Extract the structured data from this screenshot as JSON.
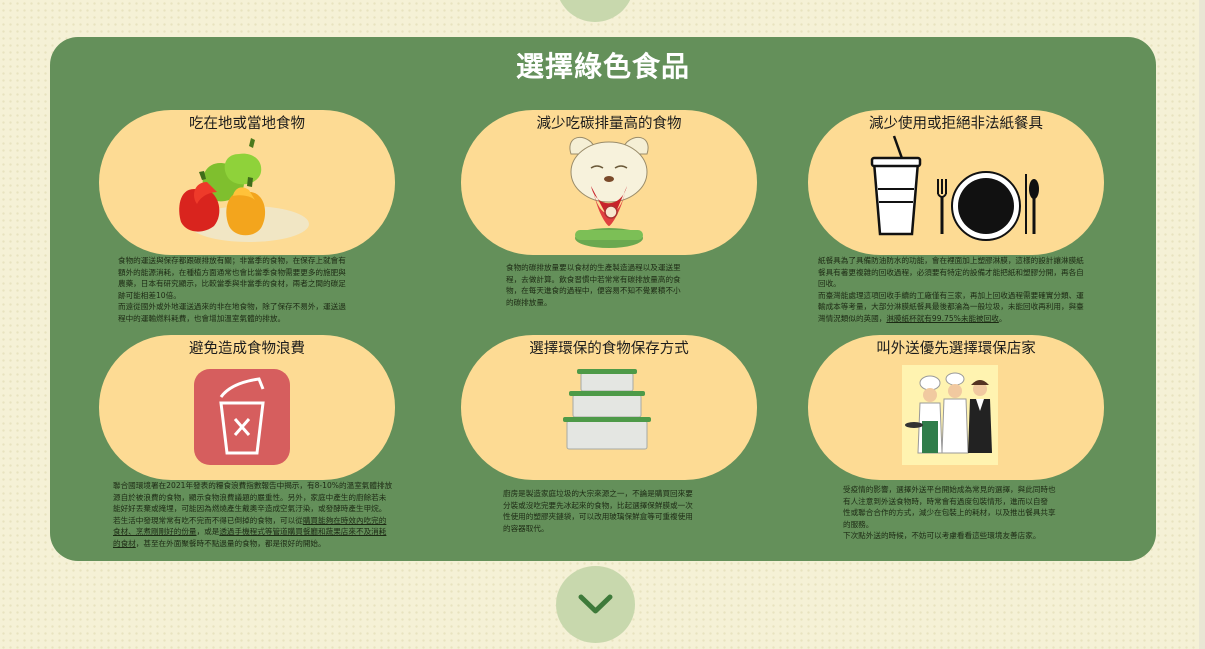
{
  "page": {
    "title": "選擇綠色食品",
    "accent": "#64905a",
    "card_color": "#fddb94",
    "background": "#f5f1d6"
  },
  "cards": [
    {
      "title": "吃在地或當地食物",
      "icon": "bell-peppers-icon",
      "desc": [
        "食物的運送與保存都跟碳排放有關；非當季的食物，在保存上就會有",
        "額外的能源消耗，在種植方面通常也會比當季食物需要更多的施肥與",
        "農藥，日本有研究顯示，比較當季與非當季的食材，兩者之間的碳足",
        "跡可能相差10倍。",
        "而遠從國外或外地運送過來的非在地食物，除了保存不易外，運送過",
        "程中的運輸燃料耗費，也會增加溫室氣體的排放。"
      ]
    },
    {
      "title": "減少吃碳排量高的食物",
      "icon": "dog-eating-steak-icon",
      "desc": [
        "食物的碳排放量要以食材的生產製造過程以及運送里",
        "程，去做計算。飲食習慣中若常常有碳排放量高的食",
        "物，在每天進食的過程中，便容易不知不覺累積不小",
        "的碳排放量。"
      ]
    },
    {
      "title": "減少使用或拒絕非法紙餐具",
      "icon": "cup-and-tableware-icon",
      "desc": [
        "紙餐具為了具備防油防水的功能，會在裡面加上塑膠淋膜，這樣的設計讓淋膜紙",
        "餐具有著更複雜的回收過程，必須要有特定的設備才能把紙和塑膠分開，再各自",
        "回收。",
        "而臺灣能處理這項回收手續的工廠僅有三家，再加上回收過程需要確實分類、運",
        "輸成本等考量，大部分淋膜紙餐具最後都淪為一般垃圾，未能回收再利用，與臺",
        "灣情況類似的英國，"
      ],
      "desc_link": "淋膜紙杯就有99.75%未能被回收",
      "desc_end": "。"
    },
    {
      "title": "避免造成食物浪費",
      "icon": "no-waste-bin-icon",
      "desc": [
        "聯合國環境署在2021年發表的糧食浪費指數報告中揭示，有8-10%的溫室氣體排放",
        "源自於被浪費的食物，顯示食物浪費議題的嚴重性。另外，家庭中產生的廚餘若未",
        "能好好丟棄或掩埋，可能因為燃燒產生戴奧辛造成空氣汙染，或發酵時產生甲烷。",
        "若生活中發現常常有吃不完而不得已倒掉的食物，可以從"
      ],
      "desc_link1": "購買能夠在時效內吃完的",
      "desc_link2": "食材、烹煮剛剛好的份量",
      "desc_mid": "，或是",
      "desc_link3": "透過手機程式等管道購買餐廳和蔬果店來不及消耗",
      "desc_link4": "的食材",
      "desc_end": "，甚至在外面聚餐時不點過量的食物，都是很好的開始。"
    },
    {
      "title": "選擇環保的食物保存方式",
      "icon": "food-containers-icon",
      "desc": [
        "廚房是製造家庭垃圾的大宗來源之一，不論是購買回來要",
        "分裝或沒吃完要先冰起來的食物，比起選擇保鮮膜或一次",
        "性使用的塑膠夾鏈袋，可以改用玻璃保鮮盒等可重複使用",
        "的容器取代。"
      ]
    },
    {
      "title": "叫外送優先選擇環保店家",
      "icon": "chefs-and-waiter-icon",
      "desc": [
        "受疫情的影響，選擇外送平台開始成為常見的選擇，與此同時也",
        "有人注意到外送食物時，時常會有過度包裝情形，進而以自發",
        "性或聯合合作的方式，減少在包裝上的耗材，以及推出餐具共享",
        "的服務。",
        "下次點外送的時候，不妨可以考慮看看這些環境友善店家。"
      ]
    }
  ],
  "nav": {
    "scroll_down_icon": "chevron-down-icon"
  }
}
